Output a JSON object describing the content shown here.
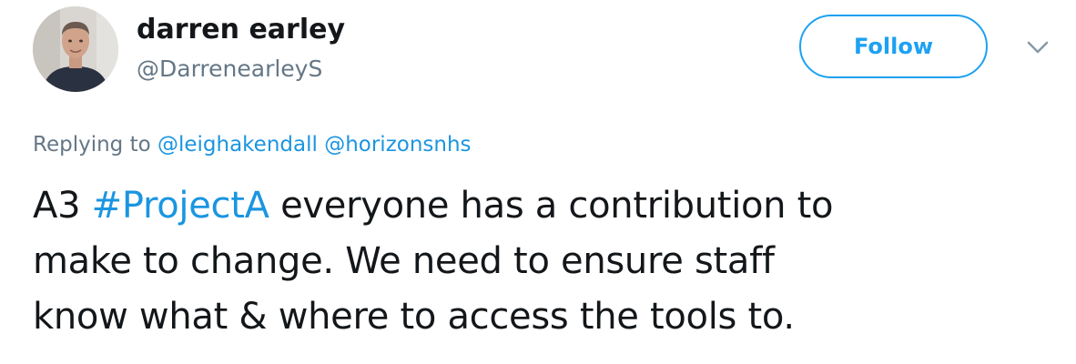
{
  "user": {
    "display_name": "darren earley",
    "handle": "@DarrenearleyS"
  },
  "actions": {
    "follow_label": "Follow",
    "menu_icon": "chevron-down-icon"
  },
  "reply": {
    "prefix": "Replying to",
    "mentions": [
      "@leighakendall",
      "@horizonsnhs"
    ]
  },
  "tweet": {
    "line1_before": "A3 ",
    "hashtag": "#ProjectA",
    "line1_after": " everyone has a contribution to",
    "line2": "make to change. We need to ensure staff",
    "line3": "know what & where to access the tools to."
  },
  "colors": {
    "link": "#1b95e0",
    "follow_border": "#1da1f2",
    "secondary_text": "#657786",
    "primary_text": "#14171a"
  }
}
